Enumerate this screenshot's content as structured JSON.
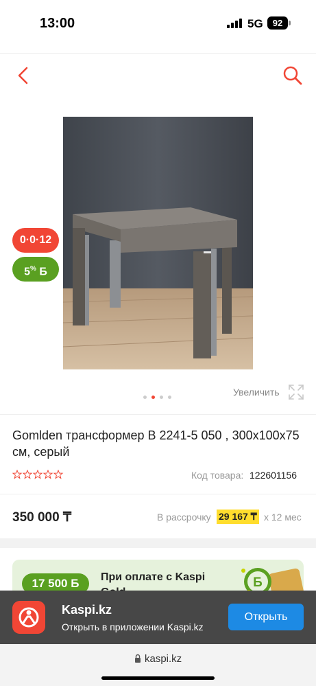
{
  "status_bar": {
    "time": "13:00",
    "network": "5G",
    "battery": "92"
  },
  "header": {
    "back_icon": "chevron-left-icon",
    "search_icon": "search-icon",
    "accent_color": "#f14635"
  },
  "gallery": {
    "installment_badge": "0·0·12",
    "bonus_badge_value": "5",
    "bonus_badge_sup": "%",
    "bonus_badge_currency": "Б",
    "zoom_label": "Увеличить",
    "total_images": 4,
    "active_index": 1
  },
  "product": {
    "title": "Gomlden трансформер В 2241-5 050 , 300x100x75 см, серый",
    "rating_stars": 0,
    "code_label": "Код товара:",
    "code_value": "122601156",
    "price": "350 000 ₸",
    "installment_prefix": "В рассрочку",
    "installment_amount": "29 167 ₸",
    "installment_suffix": "x 12 мес"
  },
  "promo": {
    "bonus_amount": "17 500 Б",
    "text": "При оплате с Kaspi Gold"
  },
  "app_banner": {
    "name": "Kaspi.kz",
    "subtitle": "Открыть в приложении Kaspi.kz",
    "open_label": "Открыть",
    "button_color": "#1d8ae4"
  },
  "browser": {
    "url": "kaspi.kz"
  }
}
